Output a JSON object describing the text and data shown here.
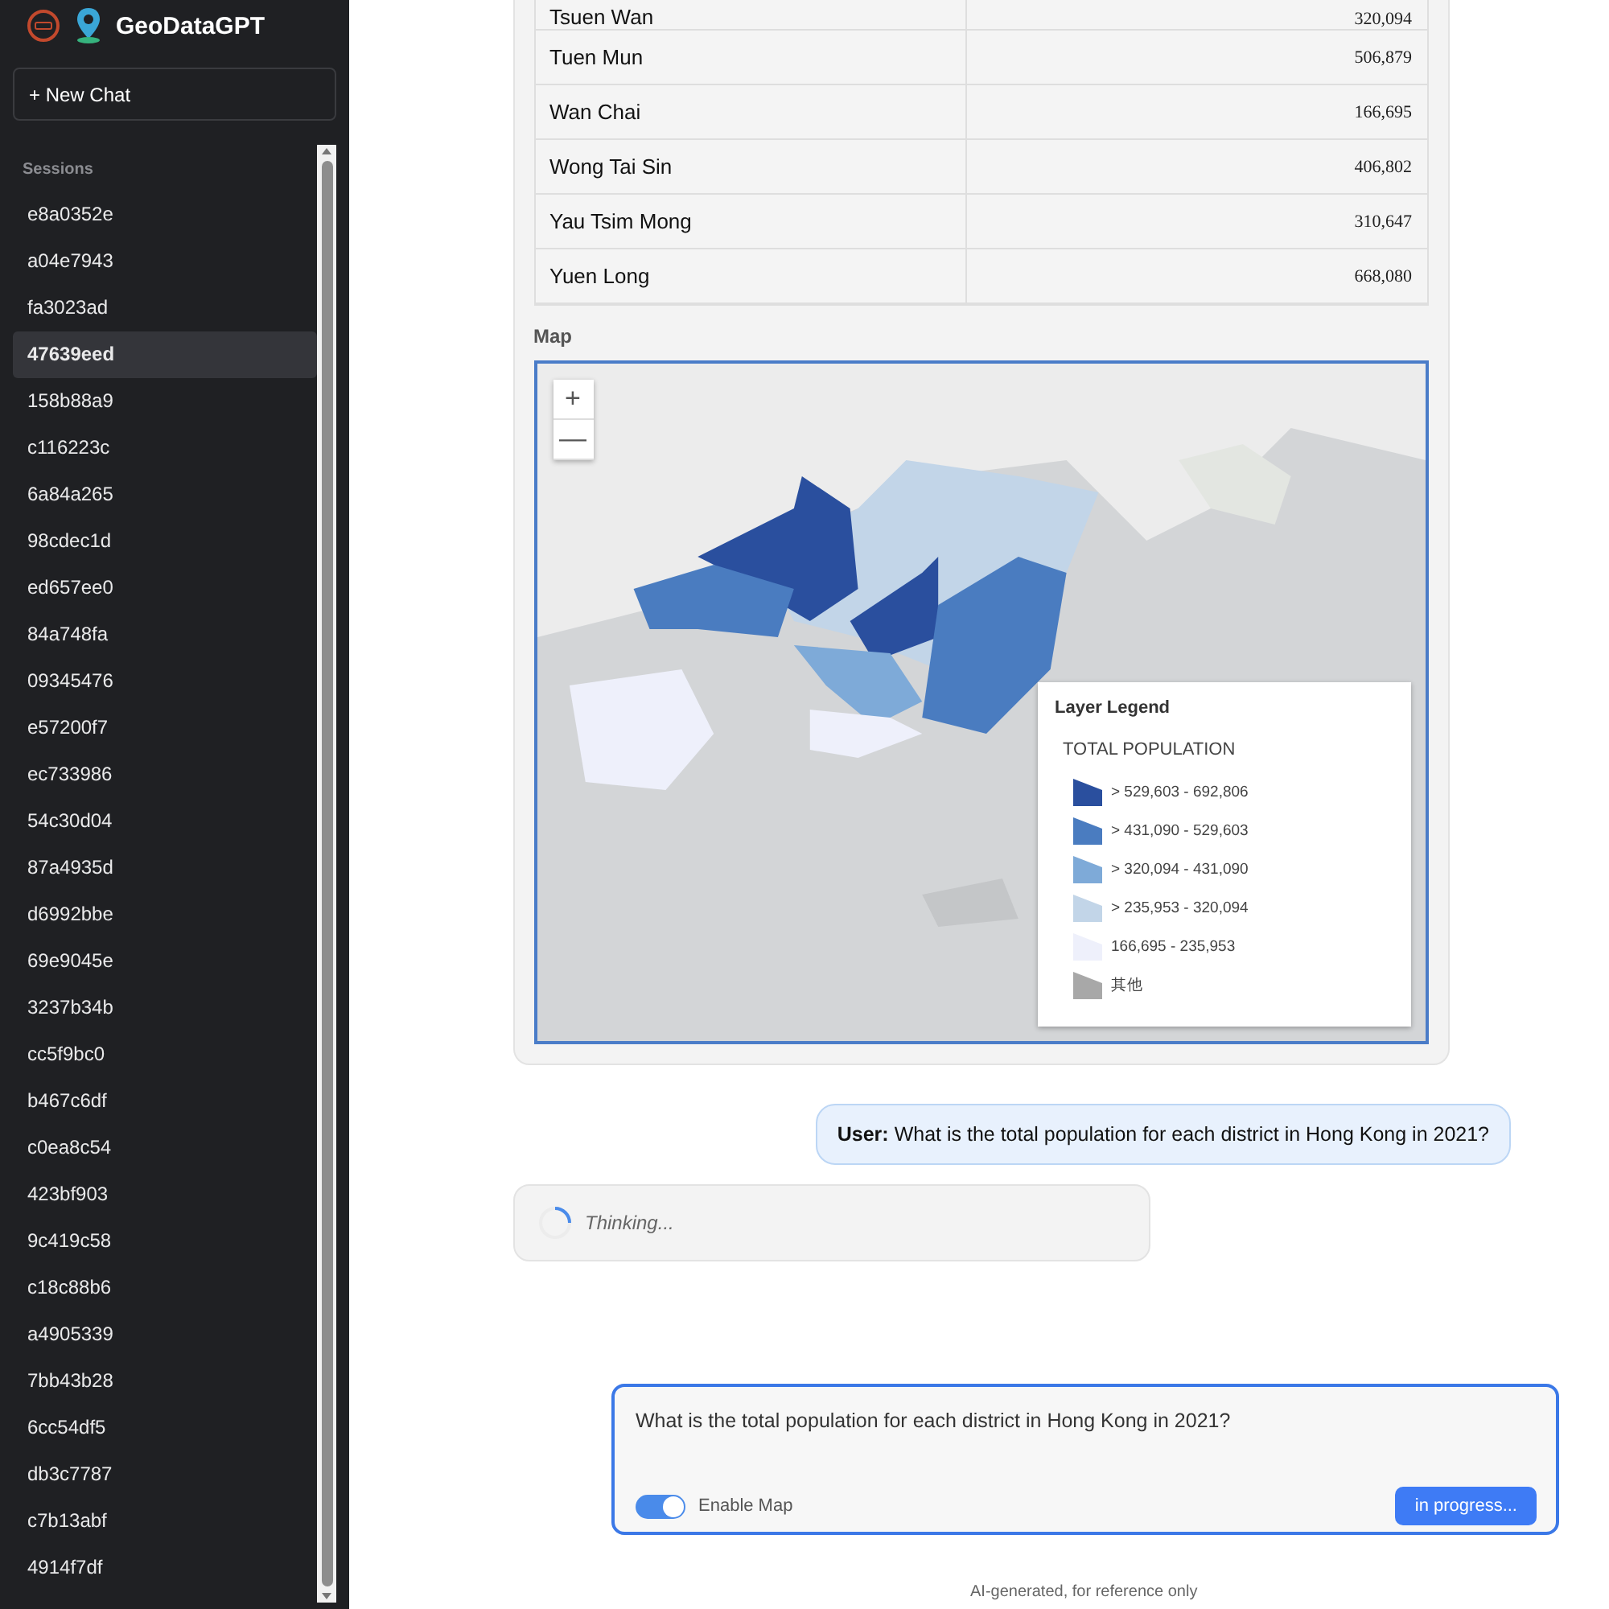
{
  "sidebar": {
    "brand": "GeoDataGPT",
    "new_chat": "+ New Chat",
    "sessions_label": "Sessions",
    "sessions": [
      {
        "label": "e8a0352e",
        "selected": false
      },
      {
        "label": "a04e7943",
        "selected": false
      },
      {
        "label": "fa3023ad",
        "selected": false
      },
      {
        "label": "47639eed",
        "selected": true
      },
      {
        "label": "158b88a9",
        "selected": false
      },
      {
        "label": "c116223c",
        "selected": false
      },
      {
        "label": "6a84a265",
        "selected": false
      },
      {
        "label": "98cdec1d",
        "selected": false
      },
      {
        "label": "ed657ee0",
        "selected": false
      },
      {
        "label": "84a748fa",
        "selected": false
      },
      {
        "label": "09345476",
        "selected": false
      },
      {
        "label": "e57200f7",
        "selected": false
      },
      {
        "label": "ec733986",
        "selected": false
      },
      {
        "label": "54c30d04",
        "selected": false
      },
      {
        "label": "87a4935d",
        "selected": false
      },
      {
        "label": "d6992bbe",
        "selected": false
      },
      {
        "label": "69e9045e",
        "selected": false
      },
      {
        "label": "3237b34b",
        "selected": false
      },
      {
        "label": "cc5f9bc0",
        "selected": false
      },
      {
        "label": "b467c6df",
        "selected": false
      },
      {
        "label": "c0ea8c54",
        "selected": false
      },
      {
        "label": "423bf903",
        "selected": false
      },
      {
        "label": "9c419c58",
        "selected": false
      },
      {
        "label": "c18c88b6",
        "selected": false
      },
      {
        "label": "a4905339",
        "selected": false
      },
      {
        "label": "7bb43b28",
        "selected": false
      },
      {
        "label": "6cc54df5",
        "selected": false
      },
      {
        "label": "db3c7787",
        "selected": false
      },
      {
        "label": "c7b13abf",
        "selected": false
      },
      {
        "label": "4914f7df",
        "selected": false
      }
    ]
  },
  "result": {
    "rows": [
      {
        "district": "Tsuen Wan",
        "population": "320,094"
      },
      {
        "district": "Tuen Mun",
        "population": "506,879"
      },
      {
        "district": "Wan Chai",
        "population": "166,695"
      },
      {
        "district": "Wong Tai Sin",
        "population": "406,802"
      },
      {
        "district": "Yau Tsim Mong",
        "population": "310,647"
      },
      {
        "district": "Yuen Long",
        "population": "668,080"
      }
    ],
    "map_label": "Map",
    "map": {
      "zoom_in": "+",
      "zoom_out": "—",
      "legend": {
        "title": "Layer Legend",
        "field": "TOTAL POPULATION",
        "classes": [
          {
            "label": "> 529,603 - 692,806",
            "color": "#2a4f9e"
          },
          {
            "label": "> 431,090 - 529,603",
            "color": "#4a7cc0"
          },
          {
            "label": "> 320,094 - 431,090",
            "color": "#7eaad8"
          },
          {
            "label": "> 235,953 - 320,094",
            "color": "#c2d5e8"
          },
          {
            "label": "166,695 - 235,953",
            "color": "#eef0fb"
          },
          {
            "label": "其他",
            "color": "#a8a8a8"
          }
        ]
      }
    }
  },
  "messages": [
    {
      "kind": "user",
      "speaker": "User:",
      "text": "What is the total population for each district in Hong Kong in 2021?"
    },
    {
      "kind": "thinking",
      "text": "Thinking..."
    }
  ],
  "composer": {
    "value": "What is the total population for each district in Hong Kong in 2021?",
    "toggle": {
      "label": "Enable Map",
      "on": true
    },
    "button": "in progress..."
  },
  "footer": "AI-generated, for reference only"
}
